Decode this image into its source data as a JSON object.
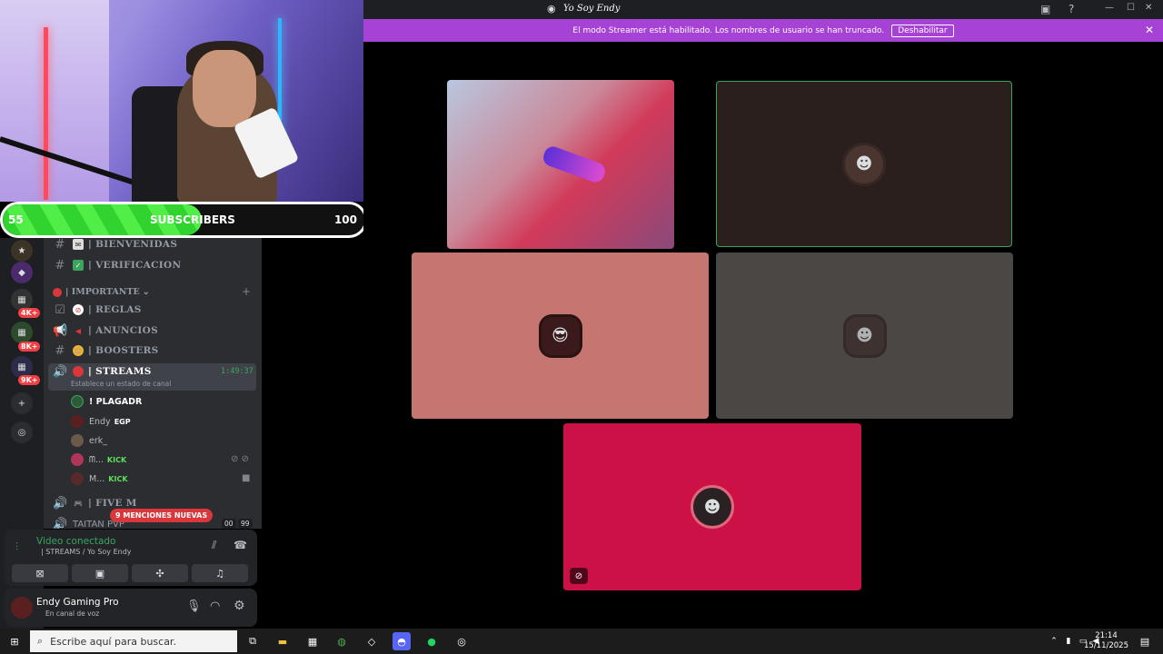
{
  "window": {
    "title": "Yo Soy Endy",
    "controls": {
      "minimize": "—",
      "maximize": "☐",
      "close": "✕"
    }
  },
  "overlay": {
    "subs_current": "55",
    "subs_label": "SUBSCRIBERS",
    "subs_goal": "100",
    "progress_fraction": 0.55
  },
  "banner": {
    "text": "El modo Streamer está habilitado. Los nombres de usuario se han truncado.",
    "button": "Deshabilitar"
  },
  "servers": {
    "badges": [
      "4K+",
      "8K+",
      "9K+"
    ]
  },
  "channels": {
    "items": [
      {
        "label": "| BIENVENIDAS"
      },
      {
        "label": "| VERIFICACION"
      },
      {
        "label": "| REGLAS"
      },
      {
        "label": "| ANUNCIOS"
      },
      {
        "label": "| BOOSTERS"
      }
    ],
    "category": "| IMPORTANTE",
    "active": {
      "label": "| STREAMS",
      "timer": "1:49:37",
      "status": "Establece un estado de canal"
    },
    "voice_users": [
      {
        "name": "! PLAGADR",
        "tag": ""
      },
      {
        "name": "Endy",
        "tag": "EGP"
      },
      {
        "name": "erk_",
        "tag": ""
      },
      {
        "name": "ᗰ...",
        "tag": "KICK"
      },
      {
        "name": "M...",
        "tag": "KICK"
      }
    ],
    "five_m": "| FIVE M",
    "taitan": "TAITAN PVP",
    "taitan_counts": [
      "00",
      "99"
    ],
    "mentions": "9 MENCIONES NUEVAS"
  },
  "voice_panel": {
    "status": "Video conectado",
    "channel": "| STREAMS / Yo Soy Endy"
  },
  "user_panel": {
    "name": "Endy Gaming Pro",
    "status": "En canal de voz"
  },
  "taskbar": {
    "search_placeholder": "Escribe aquí para buscar.",
    "time": "21:14",
    "date": "15/11/2025"
  },
  "colors": {
    "banner": "#a742d6",
    "tile_salmon": "#c57670",
    "tile_dark": "#2b1f1d",
    "tile_gray": "#4a4744",
    "tile_red": "#cc1146",
    "speaking": "#3ba55d"
  }
}
